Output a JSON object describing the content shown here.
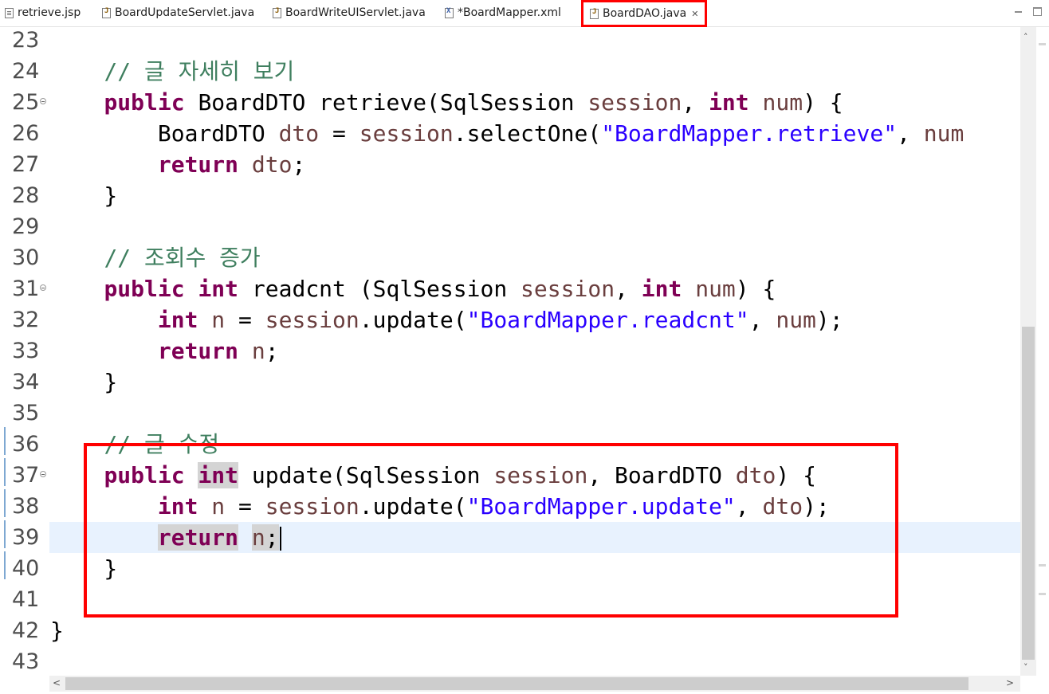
{
  "tabs": [
    {
      "label": "retrieve.jsp",
      "icon": "jsp-file-icon",
      "active": false
    },
    {
      "label": "BoardUpdateServlet.java",
      "icon": "java-file-icon",
      "active": false
    },
    {
      "label": "BoardWriteUIServlet.java",
      "icon": "java-file-icon",
      "active": false
    },
    {
      "label": "*BoardMapper.xml",
      "icon": "xml-file-icon",
      "active": false
    },
    {
      "label": "BoardDAO.java",
      "icon": "java-file-icon",
      "active": true,
      "close": "✕"
    }
  ],
  "editor": {
    "current_line": 39,
    "lines": [
      {
        "n": "23",
        "fold": false,
        "tokens": []
      },
      {
        "n": "24",
        "fold": false,
        "tokens": [
          {
            "t": "    "
          },
          {
            "t": "// 글 자세히 보기",
            "c": "cm"
          }
        ]
      },
      {
        "n": "25",
        "fold": true,
        "tokens": [
          {
            "t": "    "
          },
          {
            "t": "public",
            "c": "kw"
          },
          {
            "t": " BoardDTO retrieve(SqlSession "
          },
          {
            "t": "session",
            "c": "var"
          },
          {
            "t": ", "
          },
          {
            "t": "int",
            "c": "kw"
          },
          {
            "t": " "
          },
          {
            "t": "num",
            "c": "var"
          },
          {
            "t": ") {"
          }
        ]
      },
      {
        "n": "26",
        "fold": false,
        "tokens": [
          {
            "t": "        BoardDTO "
          },
          {
            "t": "dto",
            "c": "var"
          },
          {
            "t": " = "
          },
          {
            "t": "session",
            "c": "var"
          },
          {
            "t": ".selectOne("
          },
          {
            "t": "\"BoardMapper.retrieve\"",
            "c": "str"
          },
          {
            "t": ", "
          },
          {
            "t": "num",
            "c": "var"
          }
        ]
      },
      {
        "n": "27",
        "fold": false,
        "tokens": [
          {
            "t": "        "
          },
          {
            "t": "return",
            "c": "kw"
          },
          {
            "t": " "
          },
          {
            "t": "dto",
            "c": "var"
          },
          {
            "t": ";"
          }
        ]
      },
      {
        "n": "28",
        "fold": false,
        "tokens": [
          {
            "t": "    }"
          }
        ]
      },
      {
        "n": "29",
        "fold": false,
        "tokens": []
      },
      {
        "n": "30",
        "fold": false,
        "tokens": [
          {
            "t": "    "
          },
          {
            "t": "// 조회수 증가",
            "c": "cm"
          }
        ]
      },
      {
        "n": "31",
        "fold": true,
        "tokens": [
          {
            "t": "    "
          },
          {
            "t": "public",
            "c": "kw"
          },
          {
            "t": " "
          },
          {
            "t": "int",
            "c": "kw"
          },
          {
            "t": " readcnt (SqlSession "
          },
          {
            "t": "session",
            "c": "var"
          },
          {
            "t": ", "
          },
          {
            "t": "int",
            "c": "kw"
          },
          {
            "t": " "
          },
          {
            "t": "num",
            "c": "var"
          },
          {
            "t": ") {"
          }
        ]
      },
      {
        "n": "32",
        "fold": false,
        "tokens": [
          {
            "t": "        "
          },
          {
            "t": "int",
            "c": "kw"
          },
          {
            "t": " "
          },
          {
            "t": "n",
            "c": "var"
          },
          {
            "t": " = "
          },
          {
            "t": "session",
            "c": "var"
          },
          {
            "t": ".update("
          },
          {
            "t": "\"BoardMapper.readcnt\"",
            "c": "str"
          },
          {
            "t": ", "
          },
          {
            "t": "num",
            "c": "var"
          },
          {
            "t": ");"
          }
        ]
      },
      {
        "n": "33",
        "fold": false,
        "tokens": [
          {
            "t": "        "
          },
          {
            "t": "return",
            "c": "kw"
          },
          {
            "t": " "
          },
          {
            "t": "n",
            "c": "var"
          },
          {
            "t": ";"
          }
        ]
      },
      {
        "n": "34",
        "fold": false,
        "tokens": [
          {
            "t": "    }"
          }
        ]
      },
      {
        "n": "35",
        "fold": false,
        "tokens": []
      },
      {
        "n": "36",
        "fold": false,
        "tokens": [
          {
            "t": "    "
          },
          {
            "t": "// 글 수정",
            "c": "cm"
          }
        ]
      },
      {
        "n": "37",
        "fold": true,
        "tokens": [
          {
            "t": "    "
          },
          {
            "t": "public",
            "c": "kw"
          },
          {
            "t": " "
          },
          {
            "t": "int",
            "c": "kw occ"
          },
          {
            "t": " update(SqlSession "
          },
          {
            "t": "session",
            "c": "var"
          },
          {
            "t": ", BoardDTO "
          },
          {
            "t": "dto",
            "c": "var"
          },
          {
            "t": ") {"
          }
        ]
      },
      {
        "n": "38",
        "fold": false,
        "tokens": [
          {
            "t": "        "
          },
          {
            "t": "int",
            "c": "kw"
          },
          {
            "t": " "
          },
          {
            "t": "n",
            "c": "var"
          },
          {
            "t": " = "
          },
          {
            "t": "session",
            "c": "var"
          },
          {
            "t": ".update("
          },
          {
            "t": "\"BoardMapper.update\"",
            "c": "str"
          },
          {
            "t": ", "
          },
          {
            "t": "dto",
            "c": "var"
          },
          {
            "t": ");"
          }
        ]
      },
      {
        "n": "39",
        "fold": false,
        "tokens": [
          {
            "t": "        "
          },
          {
            "t": "return",
            "c": "kw occ"
          },
          {
            "t": " "
          },
          {
            "t": "n",
            "c": "var occ"
          },
          {
            "t": ";",
            "c": "occ"
          }
        ]
      },
      {
        "n": "40",
        "fold": false,
        "tokens": [
          {
            "t": "    }"
          }
        ]
      },
      {
        "n": "41",
        "fold": false,
        "tokens": []
      },
      {
        "n": "42",
        "fold": false,
        "tokens": [
          {
            "t": "}"
          }
        ]
      },
      {
        "n": "43",
        "fold": false,
        "tokens": []
      }
    ]
  },
  "scrollbars": {
    "up": "˄",
    "down": "˅",
    "left": "<",
    "right": ">"
  }
}
